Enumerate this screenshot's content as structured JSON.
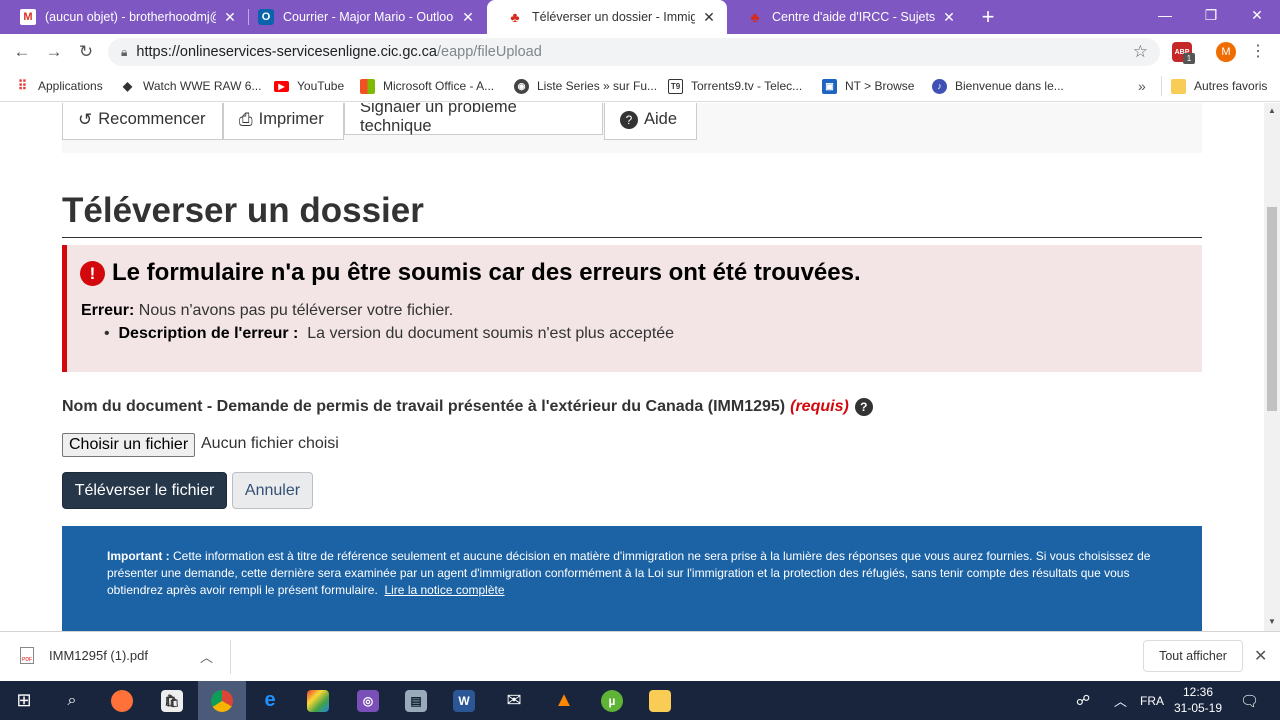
{
  "tabs": [
    {
      "title": "(aucun objet) - brotherhoodmj@",
      "icon": "gmail-icon"
    },
    {
      "title": "Courrier - Major Mario - Outlook",
      "icon": "outlook-icon"
    },
    {
      "title": "Téléverser un dossier - Immigratio",
      "icon": "maple-leaf-icon"
    },
    {
      "title": "Centre d'aide d'IRCC - Sujets en",
      "icon": "maple-leaf-icon"
    }
  ],
  "address": {
    "host": "https://onlineservices-servicesenligne.cic.gc.ca",
    "path": "/eapp/fileUpload"
  },
  "profile_initial": "M",
  "extension_badge": "1",
  "bookmarks": [
    {
      "label": "Applications"
    },
    {
      "label": "Watch WWE RAW 6..."
    },
    {
      "label": "YouTube"
    },
    {
      "label": "Microsoft Office - A..."
    },
    {
      "label": "Liste Series » sur Fu..."
    },
    {
      "label": "Torrents9.tv - Telec..."
    },
    {
      "label": "NT > Browse"
    },
    {
      "label": "Bienvenue dans le..."
    },
    {
      "label": "Autres favoris"
    }
  ],
  "page": {
    "top_buttons": {
      "restart": "Recommencer",
      "print": "Imprimer",
      "report": "Signaler un problème technique",
      "help": "Aide"
    },
    "title": "Téléverser un dossier",
    "error": {
      "heading": "Le formulaire n'a pu être soumis car des erreurs ont été trouvées.",
      "label": "Erreur:",
      "message": " Nous n'avons pas pu téléverser votre fichier.",
      "desc_label": "Description de l'erreur :",
      "desc_text": "La version du document soumis n'est plus acceptée"
    },
    "document_label": "Nom du document - Demande de permis de travail présentée à l'extérieur du Canada (IMM1295)",
    "required": "(requis)",
    "file_button": "Choisir un fichier",
    "file_status": "Aucun fichier choisi",
    "upload_button": "Téléverser le fichier",
    "cancel_button": "Annuler",
    "notice": {
      "label": "Important :",
      "text": " Cette information est à titre de référence seulement et aucune décision en matière d'immigration ne sera prise à la lumière des réponses que vous aurez fournies. Si vous choisissez de présenter une demande, cette dernière sera examinée par un agent d'immigration conformément à la Loi sur l'immigration et la protection des réfugiés, sans tenir compte des résultats que vous obtiendrez après avoir rempli le présent formulaire.",
      "link": "Lire la notice complète"
    }
  },
  "downloads": {
    "file": "IMM1295f (1).pdf",
    "show_all": "Tout afficher"
  },
  "taskbar": {
    "language": "FRA",
    "time": "12:36",
    "date": "31-05-19"
  },
  "colors": {
    "tab_strip": "#7e57c2",
    "error_red": "#d3080c",
    "primary_button": "#26374a",
    "notice_blue": "#1c63a6",
    "taskbar": "#18253d"
  }
}
